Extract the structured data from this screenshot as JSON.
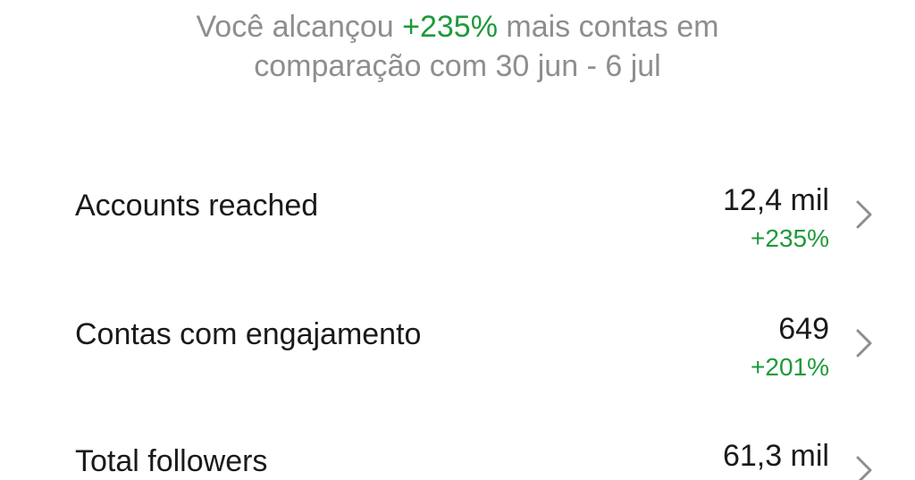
{
  "summary": {
    "prefix": "Você alcançou ",
    "highlight": "+235%",
    "suffix_line1": " mais contas em",
    "line2": "comparação com 30 jun - 6 jul"
  },
  "metrics": [
    {
      "label": "Accounts reached",
      "value": "12,4 mil",
      "change": "+235%"
    },
    {
      "label": "Contas com engajamento",
      "value": "649",
      "change": "+201%"
    },
    {
      "label": "Total followers",
      "value": "61,3 mil",
      "change": ""
    }
  ],
  "colors": {
    "positive": "#1e9a3a",
    "muted_text": "#8e8e8e",
    "primary_text": "#1a1a1a",
    "chevron": "#8e8e8e"
  },
  "icons": {
    "chevron": "chevron-right-icon"
  }
}
